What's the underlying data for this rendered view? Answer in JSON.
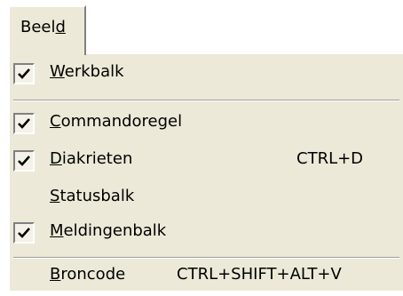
{
  "menubar": {
    "tab_prefix": "Beel",
    "tab_accel": "d"
  },
  "menu": {
    "werkbalk": {
      "accel": "W",
      "rest": "erkbalk",
      "checked": true
    },
    "commandoregel": {
      "accel": "C",
      "rest": "ommandoregel",
      "checked": true
    },
    "diakrieten": {
      "accel": "D",
      "rest": "iakrieten",
      "shortcut": "CTRL+D",
      "checked": true
    },
    "statusbalk": {
      "accel": "S",
      "rest": "tatusbalk",
      "checked": false
    },
    "meldingenbalk": {
      "accel": "M",
      "rest": "eldingenbalk",
      "checked": true
    },
    "broncode": {
      "accel": "B",
      "rest": "roncode",
      "shortcut": "CTRL+SHIFT+ALT+V",
      "checked": false
    }
  },
  "colors": {
    "menu_bg": "#ece9d8",
    "check_bg": "#f4f2e8"
  },
  "icons": {
    "check": "checkmark-icon"
  }
}
